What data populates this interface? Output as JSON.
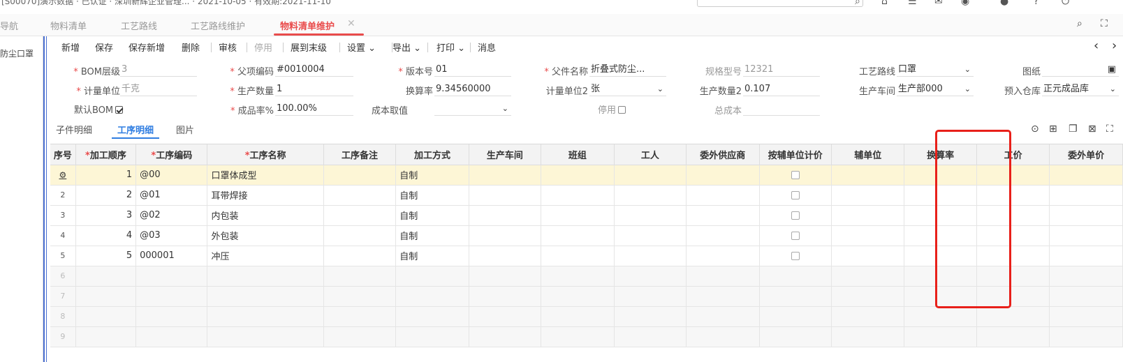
{
  "topbar": {
    "left_text": "[S00070]演示数据 · 已认证 · 深圳新辉企业管理... · 2021-10-05 · 有效期:2021-11-10"
  },
  "tabs": [
    {
      "label": "导航"
    },
    {
      "label": "物料清单"
    },
    {
      "label": "工艺路线"
    },
    {
      "label": "工艺路线维护"
    },
    {
      "label": "物料清单维护"
    }
  ],
  "left_pane": {
    "label": "防尘口罩"
  },
  "toolbar": {
    "items": [
      "新增",
      "保存",
      "保存新增",
      "删除",
      "审核",
      "停用",
      "展到末级",
      "设置",
      "导出",
      "打印",
      "消息"
    ]
  },
  "form": {
    "bom_level": {
      "label": "BOM层级",
      "value": "3"
    },
    "parent_code": {
      "label": "父项编码",
      "value": "#0010004"
    },
    "version": {
      "label": "版本号",
      "value": "01"
    },
    "parent_name": {
      "label": "父件名称",
      "value": "折叠式防尘..."
    },
    "spec": {
      "label": "规格型号",
      "value": "12321"
    },
    "route": {
      "label": "工艺路线",
      "value": "口罩"
    },
    "drawing": {
      "label": "图纸",
      "value": ""
    },
    "unit": {
      "label": "计量单位",
      "value": "千克"
    },
    "qty": {
      "label": "生产数量",
      "value": "1"
    },
    "rate": {
      "label": "换算率",
      "value": "9.34560000"
    },
    "unit2": {
      "label": "计量单位2",
      "value": "张"
    },
    "qty2": {
      "label": "生产数量2",
      "value": "0.107"
    },
    "workshop": {
      "label": "生产车间",
      "value": "生产部000"
    },
    "warehouse": {
      "label": "预入仓库",
      "value": "正元成品库"
    },
    "default_bom": {
      "label": "默认BOM"
    },
    "yield": {
      "label": "成品率%",
      "value": "100.00%"
    },
    "cost_source": {
      "label": "成本取值",
      "value": ""
    },
    "disabled": {
      "label": "停用"
    },
    "total_cost": {
      "label": "总成本",
      "value": ""
    }
  },
  "subtabs": [
    "子件明细",
    "工序明细",
    "图片"
  ],
  "grid": {
    "headers": [
      "序号",
      "加工顺序",
      "工序编码",
      "工序名称",
      "工序备注",
      "加工方式",
      "生产车间",
      "班组",
      "工人",
      "委外供应商",
      "按辅单位计价",
      "辅单位",
      "换算率",
      "工价",
      "委外单价"
    ],
    "rows": [
      {
        "no": "",
        "order": "1",
        "code": "@00",
        "name": "口罩体成型",
        "method": "自制"
      },
      {
        "no": "2",
        "order": "2",
        "code": "@01",
        "name": "耳带焊接",
        "method": "自制"
      },
      {
        "no": "3",
        "order": "3",
        "code": "@02",
        "name": "内包装",
        "method": "自制"
      },
      {
        "no": "4",
        "order": "4",
        "code": "@03",
        "name": "外包装",
        "method": "自制"
      },
      {
        "no": "5",
        "order": "5",
        "code": "000001",
        "name": "冲压",
        "method": "自制"
      }
    ],
    "empty_rows": [
      "6",
      "7",
      "8",
      "9"
    ]
  }
}
